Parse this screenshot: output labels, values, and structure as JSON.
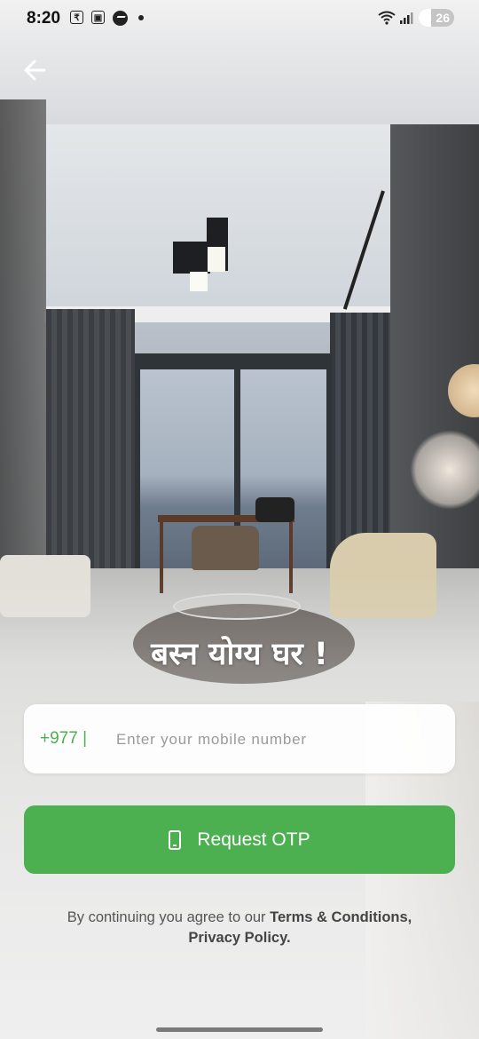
{
  "status_bar": {
    "time": "8:20",
    "battery": "26",
    "icons": [
      "rupee-icon",
      "screenshot-icon",
      "messenger-icon",
      "dot-icon",
      "wifi-icon",
      "signal-icon",
      "battery-icon"
    ]
  },
  "header": {
    "back_icon": "arrow-left-icon"
  },
  "hero": {
    "tagline": "बस्न योग्य घर !"
  },
  "login": {
    "country_prefix": "+977 |",
    "phone_placeholder": "Enter your mobile number",
    "phone_value": "",
    "otp_button_label": "Request OTP",
    "otp_button_icon": "mobile-phone-icon",
    "button_color": "#4caf50"
  },
  "terms": {
    "prefix_text": "By continuing you agree to our ",
    "terms_link": "Terms & Conditions,",
    "privacy_link": "Privacy Policy."
  }
}
